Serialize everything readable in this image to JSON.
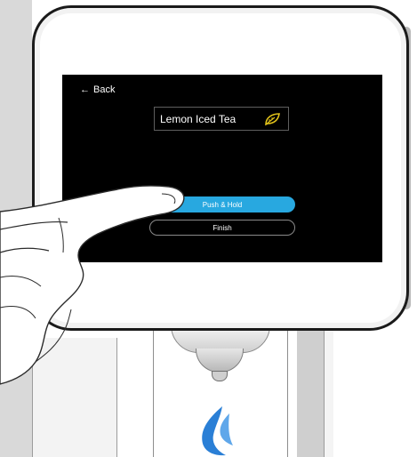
{
  "screen": {
    "back_label": "Back",
    "back_icon": "arrow-left-icon",
    "drink_name": "Lemon Iced Tea",
    "drink_icon": "leaf-icon",
    "primary_button_label": "Push & Hold",
    "secondary_button_label": "Finish"
  },
  "colors": {
    "screen_bg": "#000000",
    "accent": "#28a8e0",
    "leaf": "#e1c21a",
    "logo": "#2a7fd6"
  }
}
